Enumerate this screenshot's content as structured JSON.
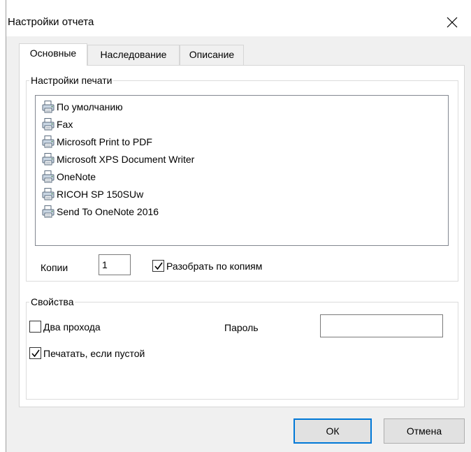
{
  "window": {
    "title": "Настройки отчета"
  },
  "tabs": [
    {
      "label": "Основные",
      "active": true
    },
    {
      "label": "Наследование",
      "active": false
    },
    {
      "label": "Описание",
      "active": false
    }
  ],
  "print_settings": {
    "group_label": "Настройки печати",
    "printers": [
      {
        "label": "По умолчанию",
        "icon": "printer-icon"
      },
      {
        "label": "Fax",
        "icon": "printer-icon"
      },
      {
        "label": "Microsoft Print to PDF",
        "icon": "printer-icon"
      },
      {
        "label": "Microsoft XPS Document Writer",
        "icon": "printer-icon"
      },
      {
        "label": "OneNote",
        "icon": "printer-icon"
      },
      {
        "label": "RICOH SP 150SUw",
        "icon": "printer-icon"
      },
      {
        "label": "Send To OneNote 2016",
        "icon": "printer-icon"
      }
    ],
    "copies_label": "Копии",
    "copies_value": "1",
    "collate_label": "Разобрать по копиям",
    "collate_checked": true
  },
  "properties": {
    "group_label": "Свойства",
    "two_pass_label": "Два прохода",
    "two_pass_checked": false,
    "password_label": "Пароль",
    "password_value": "",
    "print_if_empty_label": "Печатать, если пустой",
    "print_if_empty_checked": true
  },
  "buttons": {
    "ok_label": "ОК",
    "cancel_label": "Отмена"
  },
  "colors": {
    "accent": "#0078d7",
    "window_bg": "#f0f0f0",
    "panel_bg": "#ffffff"
  }
}
